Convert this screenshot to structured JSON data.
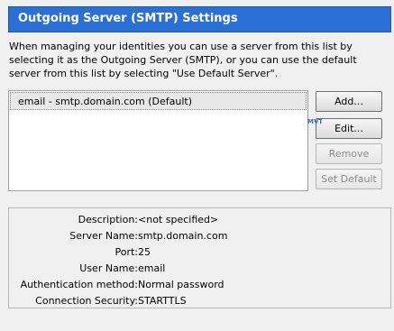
{
  "header": {
    "title": "Outgoing Server (SMTP) Settings"
  },
  "description": "When managing your identities you can use a server from this list by selecting it as the Outgoing Server (SMTP), or you can use the default server from this list by selecting \"Use Default Server\".",
  "server_list": {
    "items": [
      {
        "label": "email - smtp.domain.com (Default)",
        "selected": true
      }
    ]
  },
  "buttons": {
    "add": "Add...",
    "edit": "Edit...",
    "remove": "Remove",
    "set_default": "Set Default"
  },
  "details": [
    {
      "label": "Description:",
      "value": "<not specified>"
    },
    {
      "label": "Server Name:",
      "value": "smtp.domain.com"
    },
    {
      "label": "Port:",
      "value": "25"
    },
    {
      "label": "User Name:",
      "value": "email"
    },
    {
      "label": "Authentication method:",
      "value": "Normal password"
    },
    {
      "label": "Connection Security:",
      "value": "STARTTLS"
    }
  ],
  "colors": {
    "header_bg": "#2a6fd6",
    "disabled_text": "#8d8d8d"
  },
  "watermark": "MVTE"
}
